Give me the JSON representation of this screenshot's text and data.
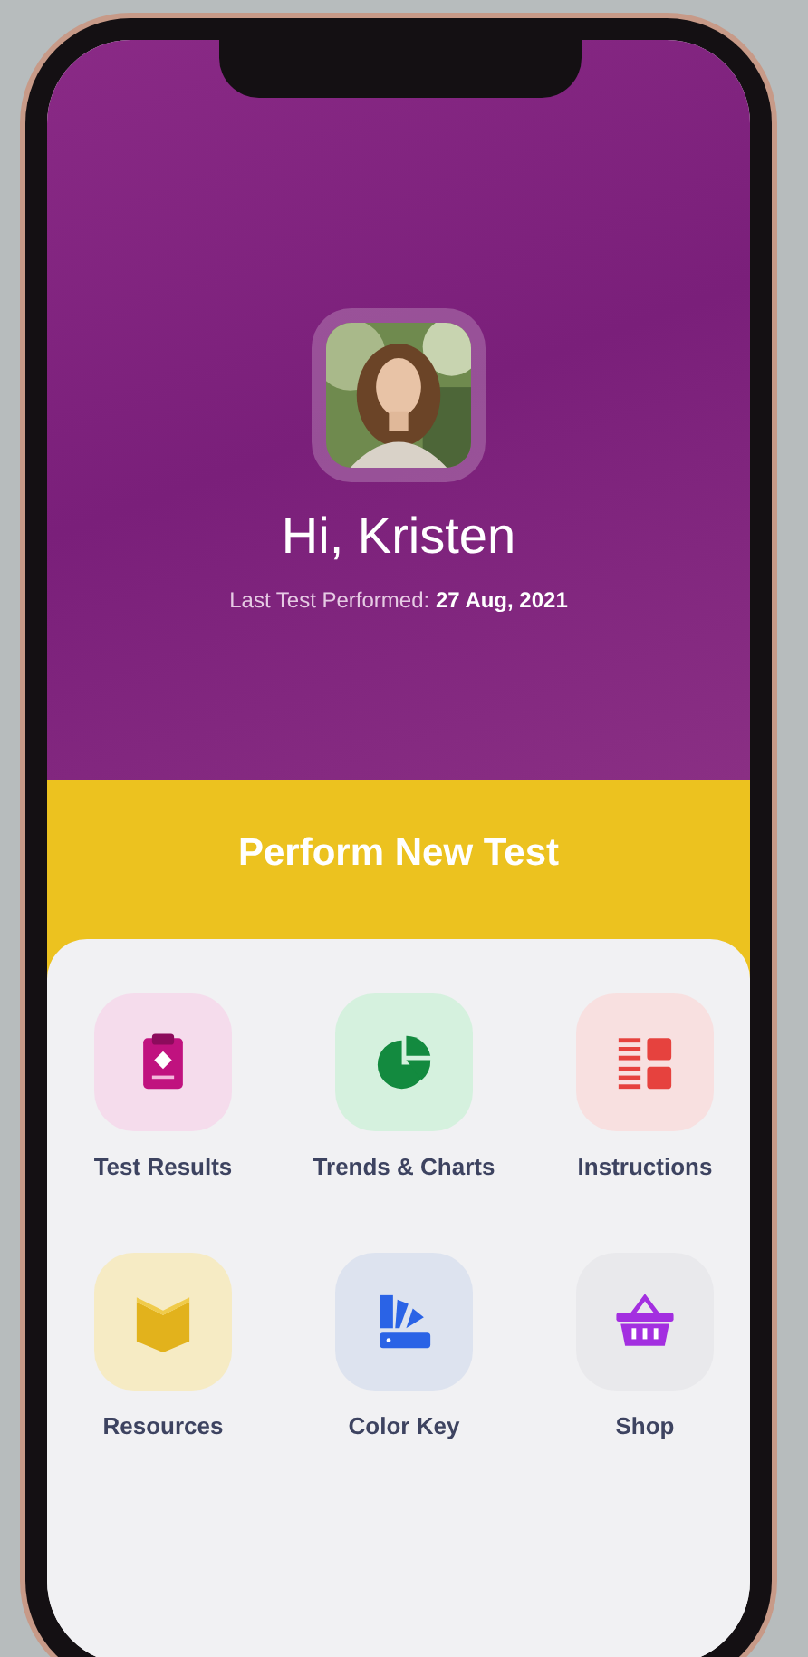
{
  "greeting": "Hi, Kristen",
  "last_test": {
    "label": "Last Test Performed:",
    "date": "27 Aug, 2021"
  },
  "primary_button": "Perform New Test",
  "menu": [
    {
      "label": "Test Results",
      "kind": "clipboard"
    },
    {
      "label": "Trends & Charts",
      "kind": "chart"
    },
    {
      "label": "Instructions",
      "kind": "grid"
    },
    {
      "label": "Resources",
      "kind": "book"
    },
    {
      "label": "Color Key",
      "kind": "swatch"
    },
    {
      "label": "Shop",
      "kind": "basket"
    }
  ]
}
